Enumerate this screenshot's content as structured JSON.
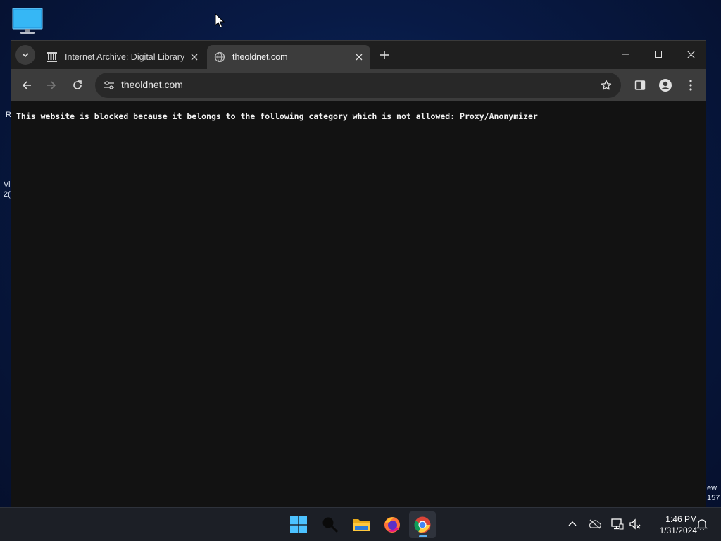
{
  "desktop": {
    "edge_text": {
      "left_1": "R",
      "left_2": "Vi",
      "left_3": "2(",
      "right_1": "ew",
      "right_2": "157"
    }
  },
  "browser": {
    "tabs": [
      {
        "title": "Internet Archive: Digital Library",
        "icon": "archive-columns-icon",
        "active": false
      },
      {
        "title": "theoldnet.com",
        "icon": "globe-icon",
        "active": true
      }
    ],
    "address_bar": {
      "url": "theoldnet.com"
    },
    "page": {
      "message": "This website is blocked because it belongs to the following category which is not allowed: Proxy/Anonymizer"
    }
  },
  "taskbar": {
    "apps": [
      {
        "name": "start",
        "icon": "windows-logo-icon"
      },
      {
        "name": "search",
        "icon": "search-icon"
      },
      {
        "name": "file-explorer",
        "icon": "folder-icon"
      },
      {
        "name": "firefox",
        "icon": "firefox-icon"
      },
      {
        "name": "chrome",
        "icon": "chrome-icon",
        "active": true
      }
    ],
    "clock": {
      "time": "1:46 PM",
      "date": "1/31/2024"
    }
  },
  "colors": {
    "accent": "#5cb0f0",
    "content_bg": "#121212",
    "toolbar_bg": "#3c3c3c"
  }
}
